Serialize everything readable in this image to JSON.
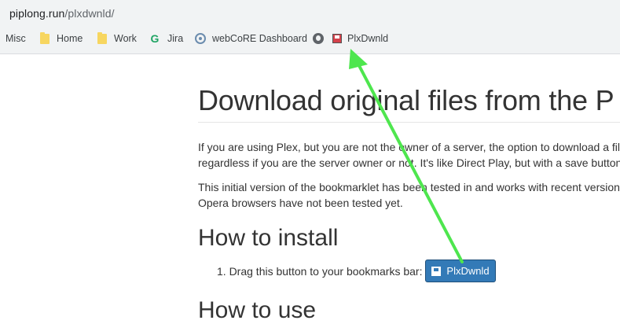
{
  "browser": {
    "url_host": "piplong.run",
    "url_path": "/plxdwnld/",
    "bookmarks": [
      {
        "label": "Misc",
        "icon": "none"
      },
      {
        "label": "Home",
        "icon": "folder-icon"
      },
      {
        "label": "Work",
        "icon": "folder-icon"
      },
      {
        "label": "Jira",
        "icon": "g-icon"
      },
      {
        "label": "webCoRE Dashboard",
        "icon": "hub-icon"
      },
      {
        "label": "",
        "icon": "globe-icon"
      },
      {
        "label": "PlxDwnld",
        "icon": "floppy-icon"
      }
    ]
  },
  "page": {
    "title": "Download original files from the P",
    "intro_line1": "If you are using Plex, but you are not the owner of a server, the option to download a fil",
    "intro_line2": "regardless if you are the server owner or not. It's like Direct Play, but with a save button",
    "note_line1": "This initial version of the bookmarklet has been tested in and works with recent version",
    "note_line2": "Opera browsers have not been tested yet.",
    "install_heading": "How to install",
    "install_step": "1. Drag this button to your bookmarks bar:",
    "bookmarklet_button": "PlxDwnld",
    "use_heading": "How to use"
  },
  "colors": {
    "accent_button": "#337ab7",
    "arrow": "#4ee64e"
  }
}
